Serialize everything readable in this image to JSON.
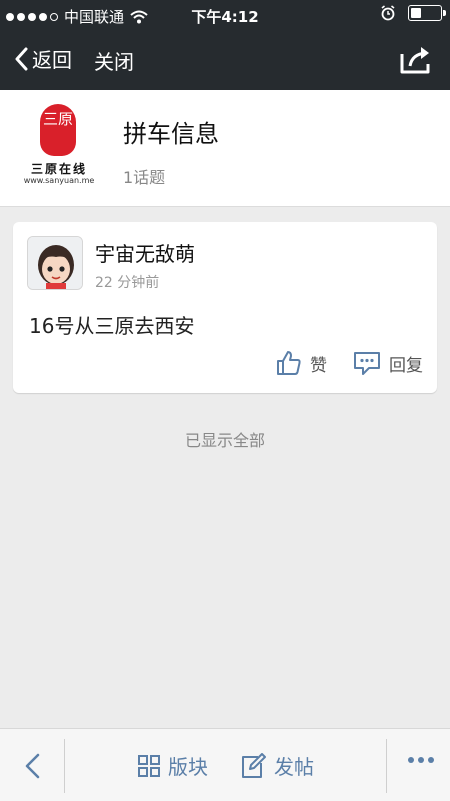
{
  "status_bar": {
    "carrier": "中国联通",
    "time": "下午4:12",
    "battery_level": 0.35
  },
  "nav": {
    "back_label": "返回",
    "close_label": "关闭"
  },
  "board": {
    "logo_char": "三原",
    "logo_name": "三原在线",
    "logo_url": "www.sanyuan.me",
    "title": "拼车信息",
    "topic_count": "1话题"
  },
  "post": {
    "author": "宇宙无敌萌",
    "time": "22 分钟前",
    "content": "16号从三原去西安",
    "like_label": "赞",
    "reply_label": "回复"
  },
  "list_footer": "已显示全部",
  "toolbar": {
    "sections_label": "版块",
    "post_label": "发帖"
  },
  "colors": {
    "nav_bg": "#262b2f",
    "accent": "#5b7fa8",
    "logo_red": "#d9202a"
  }
}
